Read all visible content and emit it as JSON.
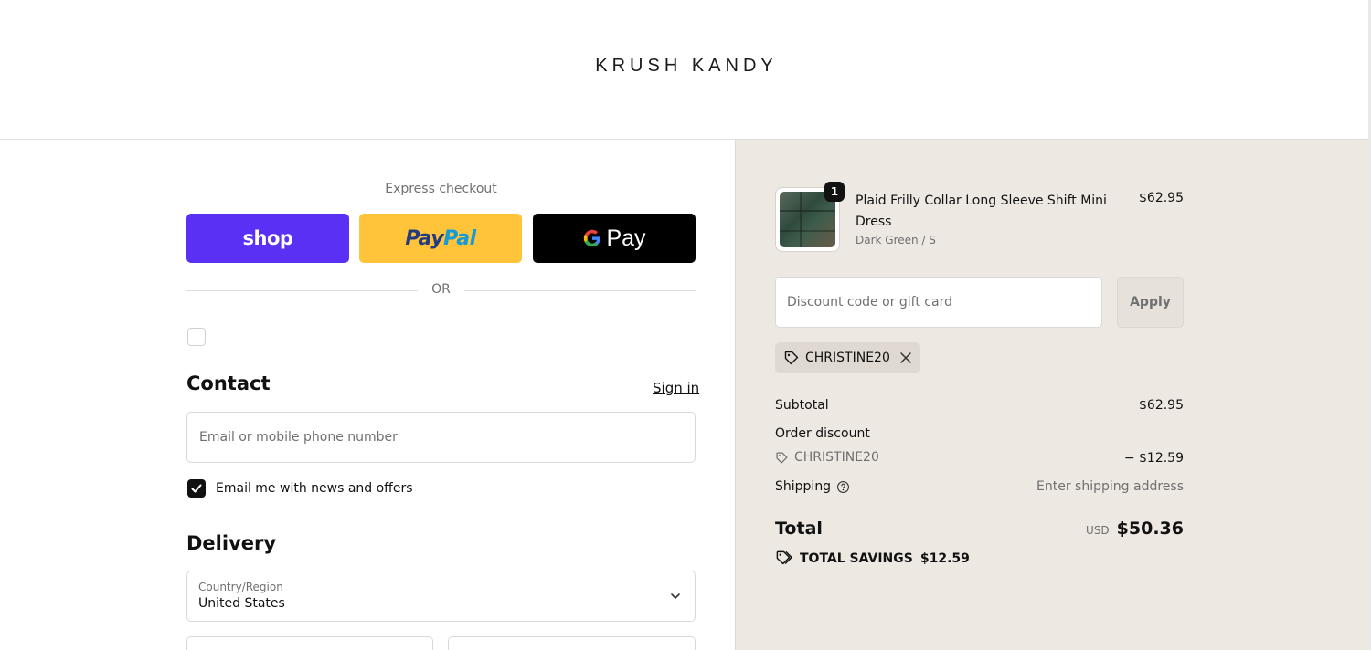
{
  "header": {
    "logo": "KRUSH KANDY"
  },
  "express": {
    "title": "Express checkout",
    "shop_label": "shop",
    "paypal_label_1": "Pay",
    "paypal_label_2": "Pal",
    "gpay_label": "Pay",
    "or_label": "OR"
  },
  "contact": {
    "title": "Contact",
    "sign_in": "Sign in",
    "email_placeholder": "Email or mobile phone number",
    "newsletter_label": "Email me with news and offers",
    "newsletter_checked": true
  },
  "delivery": {
    "title": "Delivery",
    "country_label": "Country/Region",
    "country_value": "United States"
  },
  "cart": {
    "item": {
      "name": "Plaid Frilly Collar Long Sleeve Shift Mini Dress",
      "variant": "Dark Green / S",
      "price": "$62.95",
      "quantity": "1"
    },
    "discount_placeholder": "Discount code or gift card",
    "apply_label": "Apply",
    "applied_code": "CHRISTINE20"
  },
  "summary": {
    "subtotal_label": "Subtotal",
    "subtotal_value": "$62.95",
    "order_discount_label": "Order discount",
    "discount_code": "CHRISTINE20",
    "discount_value": "− $12.59",
    "shipping_label": "Shipping",
    "shipping_value": "Enter shipping address",
    "total_label": "Total",
    "currency": "USD",
    "total_value": "$50.36",
    "savings_label": "TOTAL SAVINGS",
    "savings_value": "$12.59"
  },
  "colors": {
    "shop_purple": "#5a31f4",
    "paypal_yellow": "#ffc439",
    "aside_bg": "#ede8e2"
  }
}
